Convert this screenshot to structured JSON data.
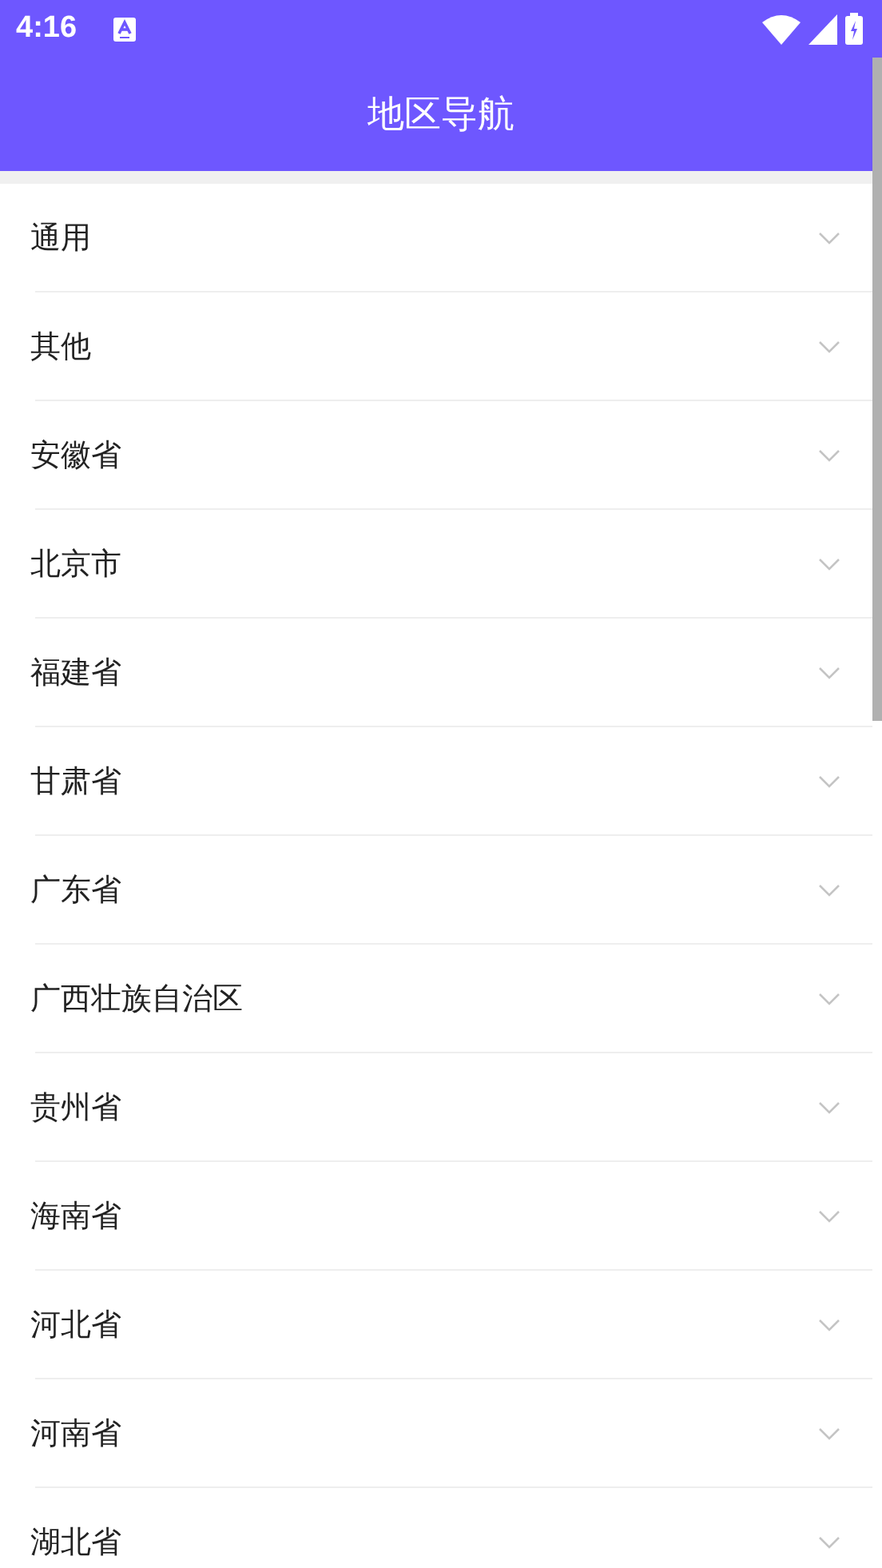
{
  "status_bar": {
    "time": "4:16"
  },
  "app_bar": {
    "title": "地区导航"
  },
  "regions": [
    {
      "label": "通用",
      "expanded": false
    },
    {
      "label": "其他",
      "expanded": false
    },
    {
      "label": "安徽省",
      "expanded": false
    },
    {
      "label": "北京市",
      "expanded": false
    },
    {
      "label": "福建省",
      "expanded": false
    },
    {
      "label": "甘肃省",
      "expanded": false
    },
    {
      "label": "广东省",
      "expanded": false
    },
    {
      "label": "广西壮族自治区",
      "expanded": false
    },
    {
      "label": "贵州省",
      "expanded": false
    },
    {
      "label": "海南省",
      "expanded": false
    },
    {
      "label": "河北省",
      "expanded": false
    },
    {
      "label": "河南省",
      "expanded": false
    },
    {
      "label": "湖北省",
      "expanded": false
    }
  ]
}
